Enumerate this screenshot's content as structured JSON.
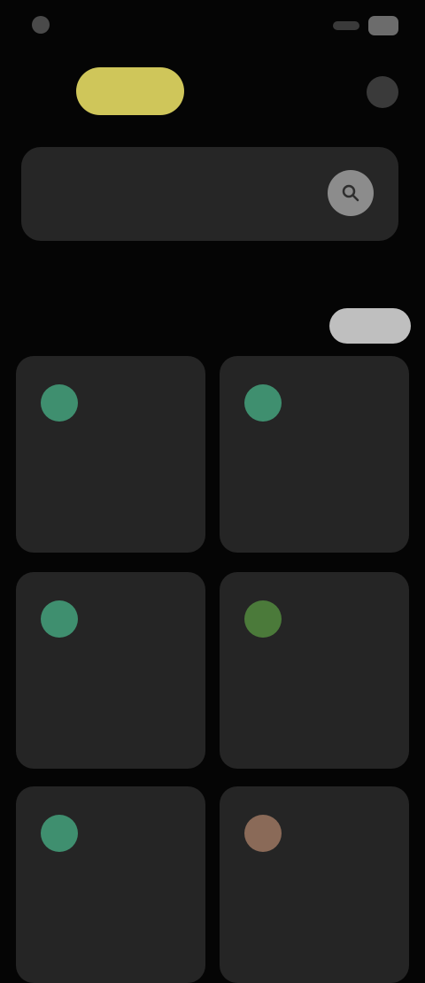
{
  "status_bar": {
    "left_text": "",
    "right_icons": [
      "signal-icon",
      "battery-icon"
    ]
  },
  "header": {
    "pill_label": "",
    "right_icon": "profile-icon"
  },
  "search": {
    "value": "",
    "placeholder": "",
    "icon": "search-icon"
  },
  "tabs": [
    {
      "label": ""
    },
    {
      "label": ""
    }
  ],
  "section": {
    "title": "",
    "action_label": ""
  },
  "cards": [
    {
      "title": "",
      "subtitle": "",
      "icon_color": "#3f8f6f"
    },
    {
      "title": "",
      "subtitle": "",
      "icon_color": "#3f8f6f"
    },
    {
      "title": "",
      "subtitle": "",
      "icon_color": "#3f8f6f"
    },
    {
      "title": "",
      "subtitle": "",
      "icon_color": "#4b7a3a"
    },
    {
      "title": "",
      "subtitle": "",
      "icon_color": "#3f8f6f"
    },
    {
      "title": "",
      "subtitle": "",
      "icon_color": "#8a6a58"
    }
  ],
  "colors": {
    "background": "#050505",
    "accent": "#cfc65a",
    "card": "#252525"
  }
}
